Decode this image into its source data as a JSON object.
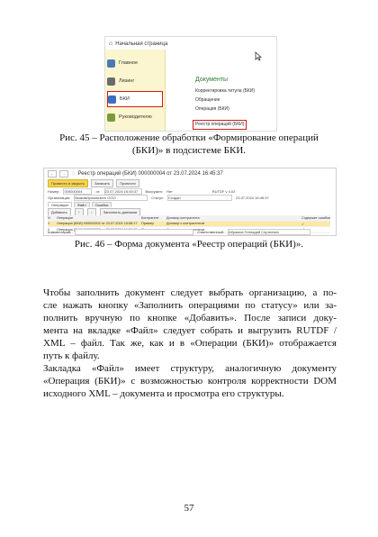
{
  "fig45": {
    "home_label": "Начальная страница",
    "sidebar": [
      {
        "label": "Главное",
        "color": "#4a7ab8"
      },
      {
        "label": "Лизинг",
        "color": "#6b6b6b"
      },
      {
        "label": "БКИ",
        "color": "#3b6fc4"
      },
      {
        "label": "Руководителю",
        "color": "#7a9a3a"
      }
    ],
    "section_title": "Документы",
    "links": [
      "Корректировка титула (БКИ)",
      "Обращение",
      "Операция (БКИ)",
      "Реестр операций (БКИ)"
    ],
    "caption": [
      "Рис. 45 – Расположение обработки «Формирование операций",
      "(БКИ)» в подсистеме БКИ."
    ]
  },
  "fig46": {
    "title": "Реестр операций (БКИ) 000000004 от 23.07.2024 16:45:37",
    "toolbar": [
      "Провести и закрыть",
      "Записать",
      "Провести"
    ],
    "row_number": {
      "label": "Номер:",
      "value": "000000004",
      "date_label": "от:",
      "date": "23.07.2024 16:45:37",
      "uploaded": "Выгружен:",
      "uploaded_val": "Нет",
      "ver": "RUTDF v 4.02"
    },
    "row_org": {
      "label": "Организация:",
      "value": "Выжимпромлизинг ООО",
      "status_label": "Статус:",
      "status": "Создан",
      "date2": "23.07.2024 16:45:37"
    },
    "tabs": [
      "Операции",
      "Файл",
      "Ошибки"
    ],
    "grid_toolbar": [
      "Добавить",
      "Заполнить данными"
    ],
    "columns": [
      "N",
      "Операция",
      "Контрагент",
      "Договор контрагента",
      "Содержит ошибки"
    ],
    "rows": [
      {
        "n": "1",
        "op": "Операция (БКИ) 000000002 от 23.07.2024 15:58:17",
        "ka": "Пример",
        "dog": "Договор с контрагентом",
        "err": "✓"
      },
      {
        "n": "2",
        "op": "Операция (БКИ) 000000003 от 23.07.2024 16:29:15",
        "ka": "Пример",
        "dog": "Договор с контрагентом",
        "err": "✓"
      }
    ],
    "comment_label": "Комментарий:",
    "responsible_label": "Ответственный:",
    "responsible": "Абрамов Геннадий Сергеевич",
    "caption": "Рис. 46 – Форма документа «Реестр операций (БКИ)»."
  },
  "body": {
    "para1": [
      "Чтобы заполнить документ следует выбрать организацию, а по-",
      "сле нажать кнопку «Заполнить операциями по статусу» или за-",
      "полнить вручную по кнопке «Добавить». После записи доку-",
      "мента на вкладке «Файл» следует собрать и выгрузить RUTDF /",
      "XML – файл. Так же, как и в «Операции (БКИ)» отображается",
      "путь к файлу."
    ],
    "para2": [
      "Закладка «Файл» имеет структуру, аналогичную документу",
      "«Операция (БКИ)» с возможностью контроля корректности DOM",
      "исходного XML – документа и просмотра его структуры."
    ]
  },
  "page_number": "57"
}
